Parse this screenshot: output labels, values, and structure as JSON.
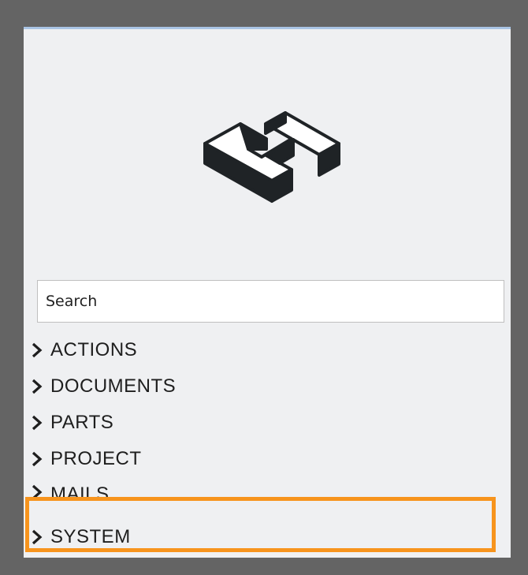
{
  "search": {
    "placeholder": "Search"
  },
  "nav": {
    "items": [
      {
        "label": "ACTIONS"
      },
      {
        "label": "DOCUMENTS"
      },
      {
        "label": "PARTS"
      },
      {
        "label": "PROJECT"
      },
      {
        "label": "MAILS"
      },
      {
        "label": "SYSTEM"
      }
    ]
  },
  "colors": {
    "frame_background": "#646464",
    "panel_background": "#eff0f2",
    "panel_top_border": "#a9c4e4",
    "highlight_border": "#f7941d",
    "logo_fill": "#1f2326"
  },
  "icons": {
    "logo": "isometric-h-logo",
    "nav_item": "chevron-right-icon"
  },
  "selection": {
    "highlighted_item": "SYSTEM"
  }
}
